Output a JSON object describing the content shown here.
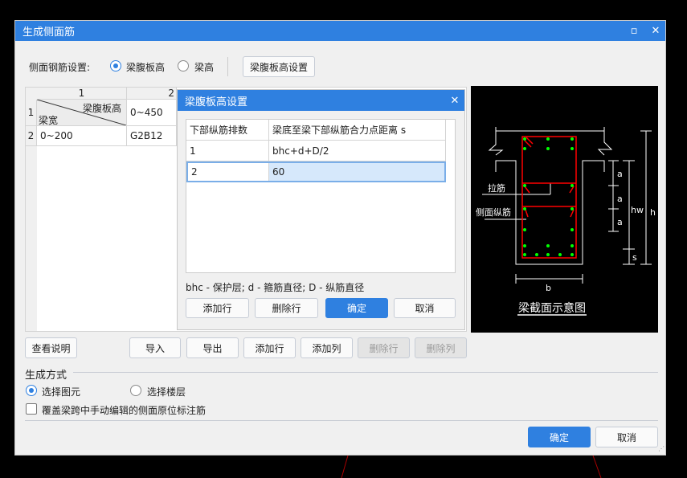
{
  "window": {
    "title": "生成侧面筋"
  },
  "side_rebar": {
    "label": "侧面钢筋设置:",
    "options": [
      "梁腹板高",
      "梁高"
    ],
    "selected": 0,
    "settings_button": "梁腹板高设置"
  },
  "grid": {
    "col_headers": [
      "1",
      "2"
    ],
    "row_headers": [
      "1",
      "2"
    ],
    "corner_top": "梁腹板高",
    "corner_bottom": "梁宽",
    "r1c2": "0~450",
    "r2c1": "0~200",
    "r2c2": "G2B12"
  },
  "subdialog": {
    "title": "梁腹板高设置",
    "columns": [
      "下部纵筋排数",
      "梁底至梁下部纵筋合力点距离 s"
    ],
    "rows": [
      [
        "1",
        "bhc+d+D/2"
      ],
      [
        "2",
        "60"
      ]
    ],
    "legend": "bhc - 保护层; d - 箍筋直径; D - 纵筋直径",
    "buttons": {
      "add_row": "添加行",
      "delete_row": "删除行",
      "ok": "确定",
      "cancel": "取消"
    }
  },
  "diagram": {
    "label_tie": "拉筋",
    "label_side": "侧面纵筋",
    "dim_a": "a",
    "dim_hw": "hw",
    "dim_s": "s",
    "dim_h": "h",
    "dim_b": "b",
    "caption": "梁截面示意图"
  },
  "toolbar": {
    "help": "查看说明",
    "import": "导入",
    "export": "导出",
    "add_row": "添加行",
    "add_col": "添加列",
    "delete_row": "删除行",
    "delete_col": "删除列"
  },
  "generation": {
    "title": "生成方式",
    "options": [
      "选择图元",
      "选择楼层"
    ],
    "selected": 0,
    "override_checkbox": "覆盖梁跨中手动编辑的侧面原位标注筋",
    "override_checked": false
  },
  "footer": {
    "ok": "确定",
    "cancel": "取消"
  },
  "colors": {
    "accent": "#2f80e0",
    "rebar": "#ff0000",
    "bar_dot": "#00ff00"
  }
}
